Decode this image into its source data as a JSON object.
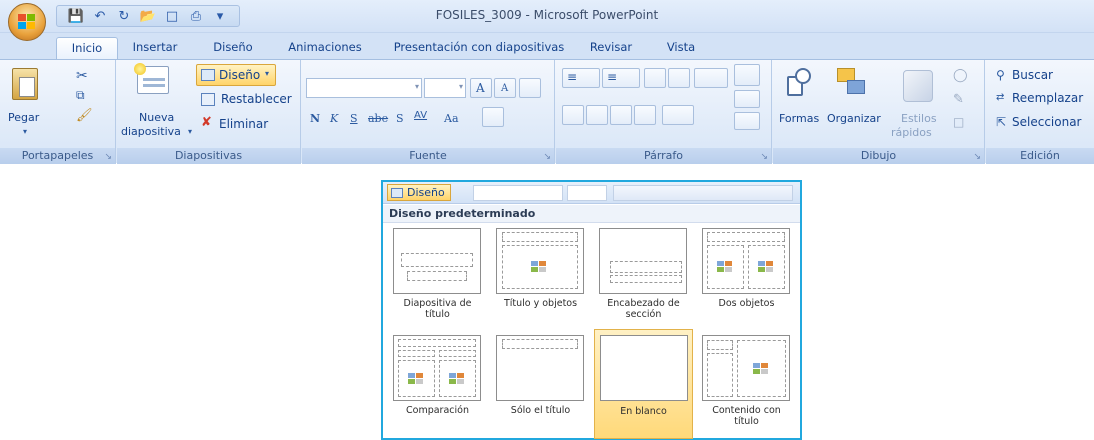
{
  "window": {
    "title": "FOSILES_3009 - Microsoft PowerPoint"
  },
  "quick_access": {
    "icons": [
      "save-icon",
      "undo-icon",
      "redo-icon",
      "open-icon",
      "new-icon",
      "print-icon",
      "customize-icon"
    ]
  },
  "tabs": [
    {
      "label": "Inicio",
      "active": true
    },
    {
      "label": "Insertar"
    },
    {
      "label": "Diseño"
    },
    {
      "label": "Animaciones"
    },
    {
      "label": "Presentación con diapositivas"
    },
    {
      "label": "Revisar"
    },
    {
      "label": "Vista"
    }
  ],
  "groups": {
    "portapapeles": {
      "label": "Portapapeles",
      "paste_label": "Pegar"
    },
    "diapositivas": {
      "label": "Diapositivas",
      "new_slide_line1": "Nueva",
      "new_slide_line2": "diapositiva",
      "layout_label": "Diseño",
      "reset_label": "Restablecer",
      "delete_label": "Eliminar"
    },
    "fuente": {
      "label": "Fuente",
      "bold": "N",
      "italic": "K",
      "underline": "S",
      "strike": "abe",
      "shadow": "S",
      "spacing": "AV",
      "case": "Aa",
      "grow": "A",
      "shrink": "A"
    },
    "parrafo": {
      "label": "Párrafo"
    },
    "dibujo": {
      "label": "Dibujo",
      "shapes_label": "Formas",
      "arrange_label": "Organizar",
      "quick_styles_line1": "Estilos",
      "quick_styles_line2": "rápidos"
    },
    "edicion": {
      "label": "Edición",
      "find_label": "Buscar",
      "replace_label": "Reemplazar",
      "select_label": "Seleccionar"
    }
  },
  "gallery": {
    "button_label": "Diseño",
    "header": "Diseño predeterminado",
    "layouts": [
      {
        "line1": "Diapositiva de",
        "line2": "título",
        "selected": false
      },
      {
        "line1": "Título y objetos",
        "line2": "",
        "selected": false
      },
      {
        "line1": "Encabezado de",
        "line2": "sección",
        "selected": false
      },
      {
        "line1": "Dos objetos",
        "line2": "",
        "selected": false
      },
      {
        "line1": "Comparación",
        "line2": "",
        "selected": false
      },
      {
        "line1": "Sólo el título",
        "line2": "",
        "selected": false
      },
      {
        "line1": "En blanco",
        "line2": "",
        "selected": true
      },
      {
        "line1": "Contenido con",
        "line2": "título",
        "selected": false
      }
    ]
  },
  "colors": {
    "accent_blue": "#15428b",
    "selection_orange": "#ffd97a",
    "gallery_border": "#21a8de"
  }
}
